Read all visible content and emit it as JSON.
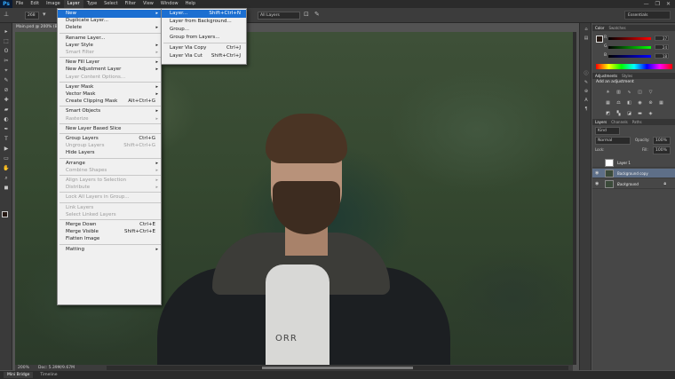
{
  "app": {
    "logo": "Ps"
  },
  "menubar": [
    "File",
    "Edit",
    "Image",
    "Layer",
    "Type",
    "Select",
    "Filter",
    "View",
    "Window",
    "Help"
  ],
  "window_controls": [
    "—",
    "❐",
    "✕"
  ],
  "options": {
    "size": "268",
    "mode": "All Layers",
    "workspace": "Essentials"
  },
  "document": {
    "tab": "Main.psd @ 200% (B..."
  },
  "status": {
    "zoom": "200%",
    "doc": "Doc: 5.39M/9.67M"
  },
  "bottom_tabs": [
    "Mini Bridge",
    "Timeline"
  ],
  "canvas_art": {
    "shirt_text": "ORR"
  },
  "layer_menu": {
    "items": [
      {
        "label": "New",
        "submenu": true,
        "highlight": true
      },
      {
        "label": "Duplicate Layer..."
      },
      {
        "label": "Delete",
        "submenu": true
      },
      {
        "sep": true
      },
      {
        "label": "Rename Layer..."
      },
      {
        "label": "Layer Style",
        "submenu": true
      },
      {
        "label": "Smart Filter",
        "submenu": true,
        "disabled": true
      },
      {
        "sep": true
      },
      {
        "label": "New Fill Layer",
        "submenu": true
      },
      {
        "label": "New Adjustment Layer",
        "submenu": true
      },
      {
        "label": "Layer Content Options...",
        "disabled": true
      },
      {
        "sep": true
      },
      {
        "label": "Layer Mask",
        "submenu": true
      },
      {
        "label": "Vector Mask",
        "submenu": true
      },
      {
        "label": "Create Clipping Mask",
        "shortcut": "Alt+Ctrl+G"
      },
      {
        "sep": true
      },
      {
        "label": "Smart Objects",
        "submenu": true
      },
      {
        "label": "Rasterize",
        "submenu": true,
        "disabled": true
      },
      {
        "sep": true
      },
      {
        "label": "New Layer Based Slice"
      },
      {
        "sep": true
      },
      {
        "label": "Group Layers",
        "shortcut": "Ctrl+G"
      },
      {
        "label": "Ungroup Layers",
        "shortcut": "Shift+Ctrl+G",
        "disabled": true
      },
      {
        "label": "Hide Layers"
      },
      {
        "sep": true
      },
      {
        "label": "Arrange",
        "submenu": true
      },
      {
        "label": "Combine Shapes",
        "submenu": true,
        "disabled": true
      },
      {
        "sep": true
      },
      {
        "label": "Align Layers to Selection",
        "submenu": true,
        "disabled": true
      },
      {
        "label": "Distribute",
        "submenu": true,
        "disabled": true
      },
      {
        "sep": true
      },
      {
        "label": "Lock All Layers in Group...",
        "disabled": true
      },
      {
        "sep": true
      },
      {
        "label": "Link Layers",
        "disabled": true
      },
      {
        "label": "Select Linked Layers",
        "disabled": true
      },
      {
        "sep": true
      },
      {
        "label": "Merge Down",
        "shortcut": "Ctrl+E"
      },
      {
        "label": "Merge Visible",
        "shortcut": "Shift+Ctrl+E"
      },
      {
        "label": "Flatten Image"
      },
      {
        "sep": true
      },
      {
        "label": "Matting",
        "submenu": true
      }
    ]
  },
  "new_submenu": {
    "items": [
      {
        "label": "Layer...",
        "shortcut": "Shift+Ctrl+N",
        "highlight": true
      },
      {
        "label": "Layer from Background..."
      },
      {
        "label": "Group..."
      },
      {
        "label": "Group from Layers..."
      },
      {
        "sep": true
      },
      {
        "label": "Layer Via Copy",
        "shortcut": "Ctrl+J"
      },
      {
        "label": "Layer Via Cut",
        "shortcut": "Shift+Ctrl+J"
      }
    ]
  },
  "color_panel": {
    "tabs": [
      "Color",
      "Swatches"
    ],
    "channels": [
      {
        "name": "R",
        "value": "37"
      },
      {
        "name": "G",
        "value": "24"
      },
      {
        "name": "B",
        "value": "18"
      }
    ]
  },
  "adjustments_panel": {
    "tabs": [
      "Adjustments",
      "Styles"
    ],
    "heading": "Add an adjustment"
  },
  "layers_panel": {
    "tabs": [
      "Layers",
      "Channels",
      "Paths"
    ],
    "kind": "Kind",
    "blend": "Normal",
    "opacity_label": "Opacity:",
    "opacity": "100%",
    "lock_label": "Lock:",
    "fill_label": "Fill:",
    "fill": "100%",
    "layers": [
      {
        "name": "Layer 1",
        "selected": false,
        "lock": false
      },
      {
        "name": "Background copy",
        "selected": true,
        "lock": false
      },
      {
        "name": "Background",
        "selected": false,
        "lock": true
      }
    ]
  },
  "colors": {
    "menu_highlight": "#1c6fd1",
    "selected_layer": "#5e6f88"
  }
}
